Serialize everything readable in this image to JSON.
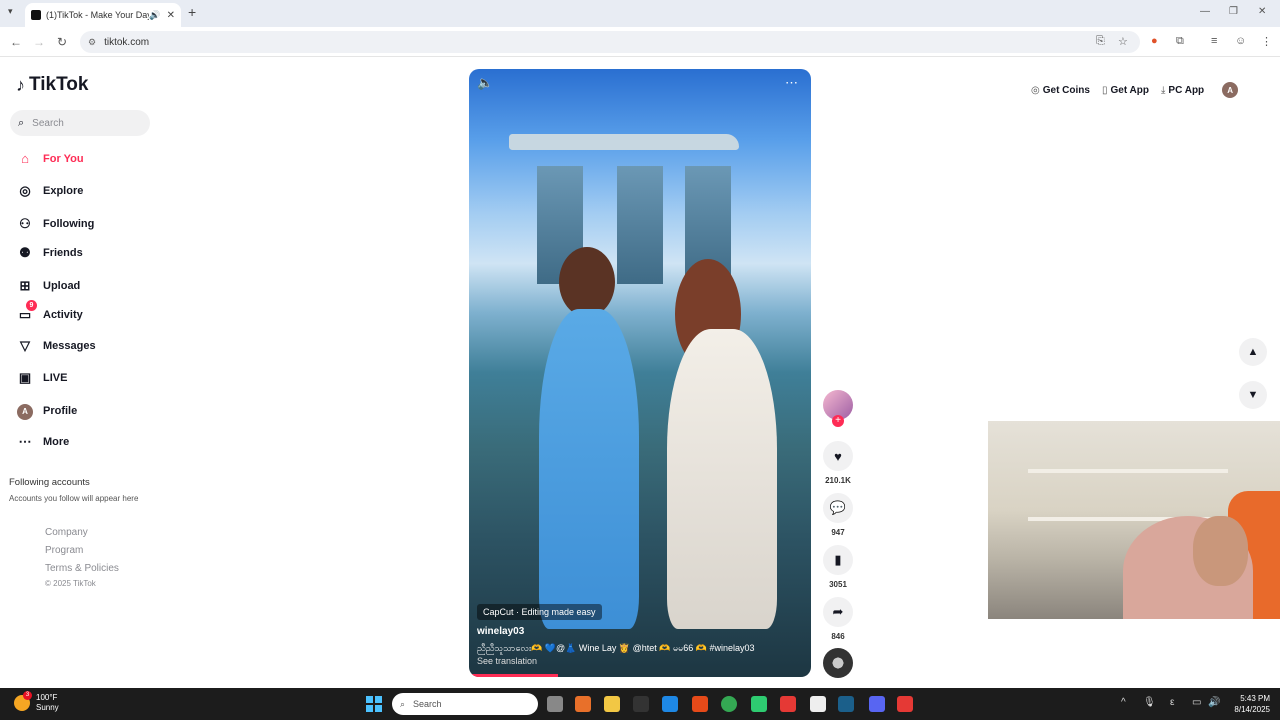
{
  "browser": {
    "tab_title": "(1)TikTok - Make Your Day",
    "url": "tiktok.com"
  },
  "sidebar": {
    "logo": "TikTok",
    "search_placeholder": "Search",
    "items": [
      {
        "label": "For You",
        "icon": "home-icon",
        "active": true
      },
      {
        "label": "Explore",
        "icon": "compass-icon"
      },
      {
        "label": "Following",
        "icon": "user-follow-icon"
      },
      {
        "label": "Friends",
        "icon": "friends-icon"
      },
      {
        "label": "Upload",
        "icon": "upload-icon"
      },
      {
        "label": "Activity",
        "icon": "activity-icon",
        "badge": "9"
      },
      {
        "label": "Messages",
        "icon": "send-icon"
      },
      {
        "label": "LIVE",
        "icon": "live-icon"
      },
      {
        "label": "Profile",
        "icon": "profile-avatar",
        "avatar_letter": "A"
      },
      {
        "label": "More",
        "icon": "more-icon"
      }
    ],
    "following_heading": "Following accounts",
    "following_sub": "Accounts you follow will appear here",
    "footer_links": [
      "Company",
      "Program",
      "Terms & Policies"
    ],
    "copyright": "© 2025 TikTok"
  },
  "video": {
    "capcut_label": "CapCut · Editing made easy",
    "username": "winelay03",
    "caption": "ညီညီသူသာလေး🫶 💙@👗 Wine Lay 👸 @htet 🫶  မမ66 🫶 #winelay03",
    "see_translation": "See translation",
    "progress": 0.26
  },
  "actions": {
    "likes": "210.1K",
    "comments": "947",
    "saves": "3051",
    "shares": "846"
  },
  "topbar": {
    "get_coins": "Get Coins",
    "get_app": "Get App",
    "pc_app": "PC App",
    "avatar_letter": "A"
  },
  "taskbar": {
    "temperature": "100°F",
    "weather": "Sunny",
    "weather_badge": "3",
    "search_placeholder": "Search",
    "time": "5:43 PM",
    "date": "8/14/2025"
  },
  "colors": {
    "accent": "#fe2c55",
    "text": "#161823",
    "taskbar": "#1c1c1c"
  }
}
